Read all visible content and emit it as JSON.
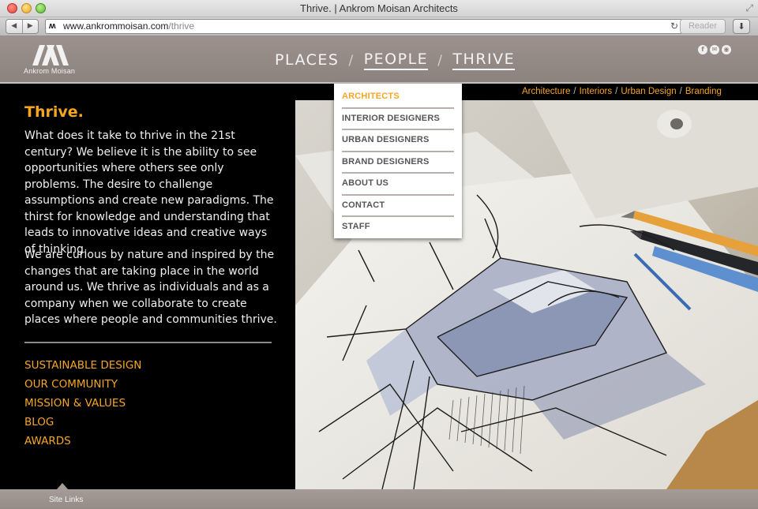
{
  "window": {
    "title": "Thrive. | Ankrom Moisan Architects"
  },
  "browser": {
    "url_host": "www.ankrommoisan.com",
    "url_path": "/thrive",
    "reader_label": "Reader",
    "back_glyph": "◀",
    "forward_glyph": "▶",
    "reload_glyph": "↻",
    "download_glyph": "⬇",
    "favicon_glyph": "ʍ"
  },
  "header": {
    "logo_text": "Ankrom Moisan",
    "nav": [
      {
        "label": "PLACES"
      },
      {
        "label": "PEOPLE"
      },
      {
        "label": "THRIVE"
      }
    ],
    "separator": "/",
    "icons": [
      "facebook-icon",
      "email-icon",
      "location-icon"
    ],
    "icon_glyphs": [
      "f",
      "✉",
      "◉"
    ]
  },
  "dropdown": {
    "items": [
      {
        "label": "ARCHITECTS"
      },
      {
        "label": "INTERIOR DESIGNERS"
      },
      {
        "label": "URBAN DESIGNERS"
      },
      {
        "label": "BRAND DESIGNERS"
      },
      {
        "label": "ABOUT US"
      },
      {
        "label": "CONTACT"
      },
      {
        "label": "STAFF"
      }
    ]
  },
  "subnav": {
    "items": [
      {
        "label": "Architecture"
      },
      {
        "label": "Interiors"
      },
      {
        "label": "Urban Design"
      },
      {
        "label": "Branding"
      }
    ],
    "separator": "/"
  },
  "content": {
    "heading": "Thrive.",
    "paragraph1": "What does it take to thrive in the 21st century? We believe it is the ability to see opportunities where others see only problems. The desire to challenge assumptions and create new paradigms. The thirst for knowledge and understanding that leads to innovative ideas and creative ways of thinking.",
    "paragraph2": "We are curious by nature and inspired by the changes that are taking place in the world around us. We thrive as individuals and as a company when we collaborate to create places where people and communities thrive.",
    "links": [
      {
        "label": "SUSTAINABLE DESIGN"
      },
      {
        "label": "OUR COMMUNITY"
      },
      {
        "label": "MISSION & VALUES"
      },
      {
        "label": "BLOG"
      },
      {
        "label": "AWARDS"
      }
    ]
  },
  "footer": {
    "label": "Site Links"
  },
  "colors": {
    "accent": "#f5a623",
    "header_bg": "#948a86",
    "panel_bg": "#000000"
  }
}
